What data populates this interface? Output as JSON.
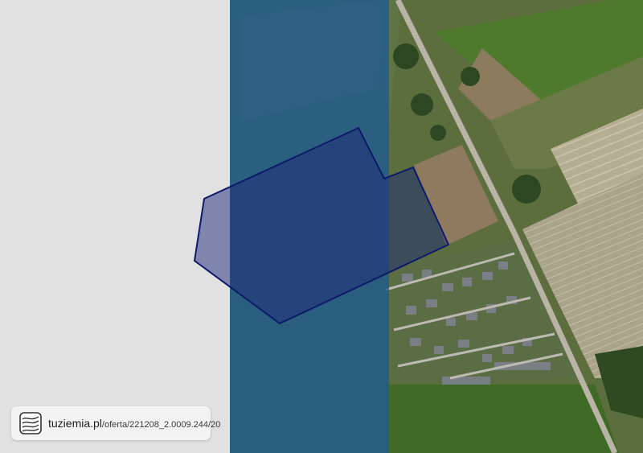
{
  "map": {
    "colors": {
      "left_panel": "#e1e1e1",
      "blue_overlay": "#1f5a8c",
      "parcel_fill": "#1e2a78",
      "parcel_stroke": "#0d1a6b",
      "field_green": "#4f6e2f",
      "road": "#b9b4a6"
    },
    "parcel": {
      "shape": "polygon",
      "description_icon": "parcel-outline"
    }
  },
  "watermark": {
    "site": "tuziemia.pl",
    "path": "/oferta/221208_2.0009.244/20",
    "icon": "contour-map-logo-icon"
  }
}
